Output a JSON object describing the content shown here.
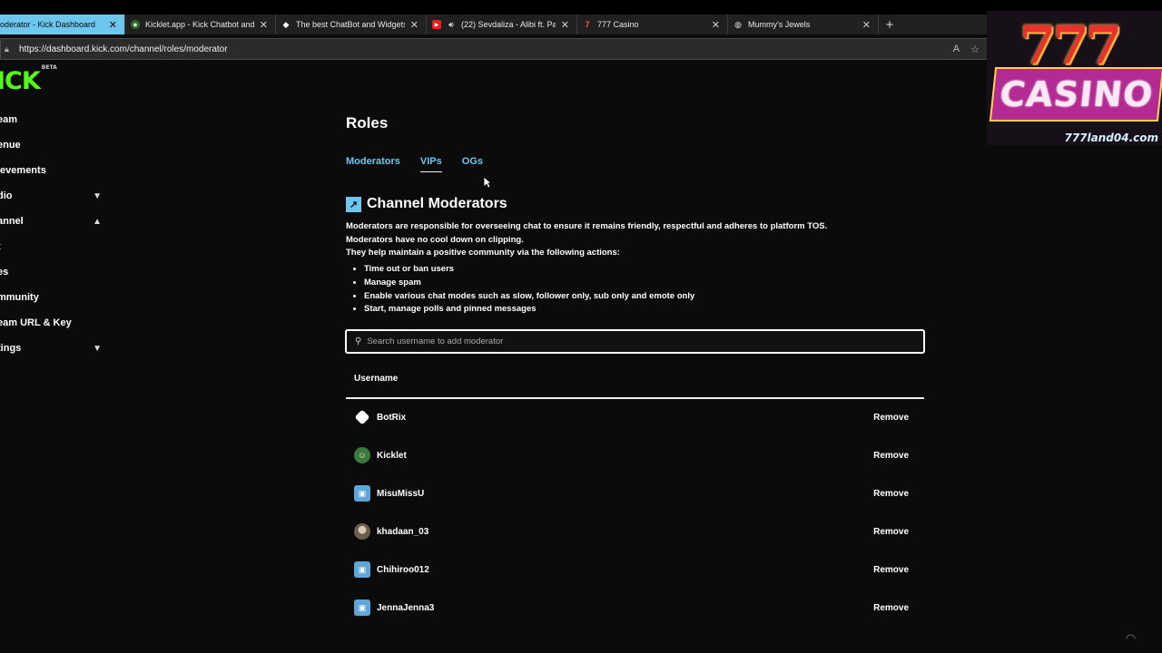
{
  "browser": {
    "tabs": [
      {
        "title": "oderator - Kick Dashboard",
        "favicon": "",
        "active": true
      },
      {
        "title": "Kicklet.app - Kick Chatbot and O",
        "favicon": "kicklet-icon",
        "active": false
      },
      {
        "title": "The best ChatBot and Widgets fo",
        "favicon": "diamond-icon",
        "active": false
      },
      {
        "title": "(22) Sevdaliza - Alibi ft. Pabl",
        "favicon": "youtube-icon",
        "active": false
      },
      {
        "title": "777 Casino",
        "favicon": "casino-icon",
        "active": false
      },
      {
        "title": "Mummy's Jewels",
        "favicon": "globe-icon",
        "active": false
      }
    ],
    "new_tab": "+",
    "url": "https://dashboard.kick.com/channel/roles/moderator"
  },
  "logo": {
    "text": "ICK",
    "badge": "BETA"
  },
  "sidebar": {
    "items": [
      {
        "label": "eam",
        "chevron": ""
      },
      {
        "label": "enue",
        "chevron": ""
      },
      {
        "label": "ievements",
        "chevron": ""
      },
      {
        "label": "dio",
        "chevron": "down"
      },
      {
        "label": "annel",
        "chevron": "up"
      },
      {
        "label": "t",
        "chevron": ""
      },
      {
        "label": "es",
        "chevron": ""
      },
      {
        "label": "mmunity",
        "chevron": ""
      },
      {
        "label": "eam URL & Key",
        "chevron": ""
      },
      {
        "label": "tings",
        "chevron": "down"
      }
    ],
    "colors": {
      "green": "#53fc18"
    }
  },
  "main": {
    "title": "Roles",
    "tabs": [
      {
        "label": "Moderators",
        "active": false
      },
      {
        "label": "VIPs",
        "active": true
      },
      {
        "label": "OGs",
        "active": false
      }
    ],
    "section_title": "Channel Moderators",
    "description": [
      "Moderators are responsible for overseeing chat to ensure it remains friendly, respectful and adheres to platform TOS.",
      "Moderators have no cool down on clipping.",
      "They help maintain a positive community via the following actions:"
    ],
    "bullets": [
      "Time out or ban users",
      "Manage spam",
      "Enable various chat modes such as slow, follower only, sub only and emote only",
      "Start, manage polls and pinned messages"
    ],
    "search_placeholder": "Search username to add moderator",
    "table_header": "Username",
    "remove_label": "Remove",
    "moderators": [
      {
        "username": "BotRix",
        "avatar": "botrix-icon",
        "avatar_color": "#ffffff"
      },
      {
        "username": "Kicklet",
        "avatar": "kicklet-icon",
        "avatar_color": "#3a7a3a"
      },
      {
        "username": "MisuMissU",
        "avatar": "default-avatar-icon",
        "avatar_color": "#5ea6d8"
      },
      {
        "username": "khadaan_03",
        "avatar": "photo-avatar",
        "avatar_color": "#8a7d6c"
      },
      {
        "username": "Chihiroo012",
        "avatar": "default-avatar-icon",
        "avatar_color": "#5ea6d8"
      },
      {
        "username": "JennaJenna3",
        "avatar": "default-avatar-icon",
        "avatar_color": "#5ea6d8"
      }
    ],
    "accent": "#6dc6ee"
  },
  "ad": {
    "sevens": "777",
    "word": "CASINO",
    "domain": "777land04.com"
  }
}
